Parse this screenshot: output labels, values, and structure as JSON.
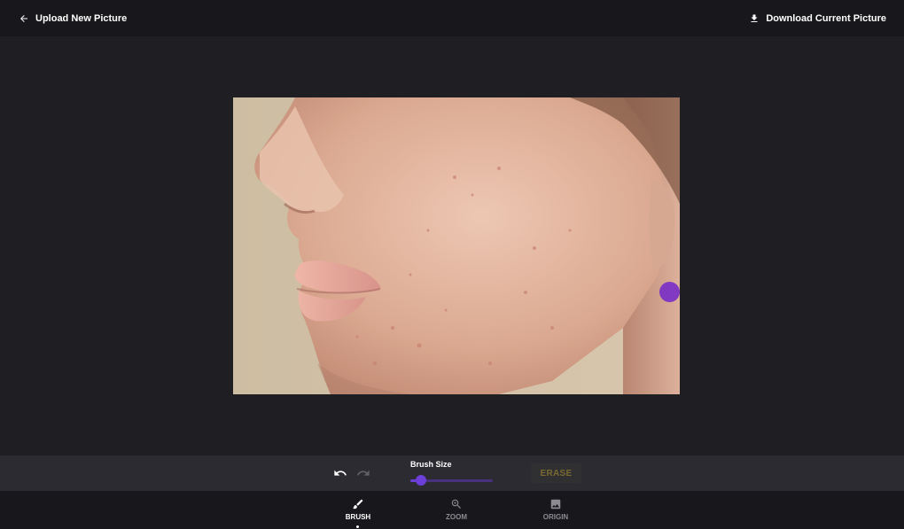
{
  "header": {
    "upload_label": "Upload New Picture",
    "download_label": "Download Current Picture"
  },
  "editor": {
    "brush_color": "#7a2fc6"
  },
  "toolbar": {
    "brush_size_label": "Brush Size",
    "brush_size_fraction": 0.13,
    "erase_label": "ERASE",
    "accent_color": "#6b3fd8"
  },
  "nav": {
    "items": [
      {
        "label": "BRUSH",
        "icon": "brush-icon",
        "active": true
      },
      {
        "label": "ZOOM",
        "icon": "zoom-in-icon",
        "active": false
      },
      {
        "label": "ORIGIN",
        "icon": "image-icon",
        "active": false
      }
    ]
  }
}
